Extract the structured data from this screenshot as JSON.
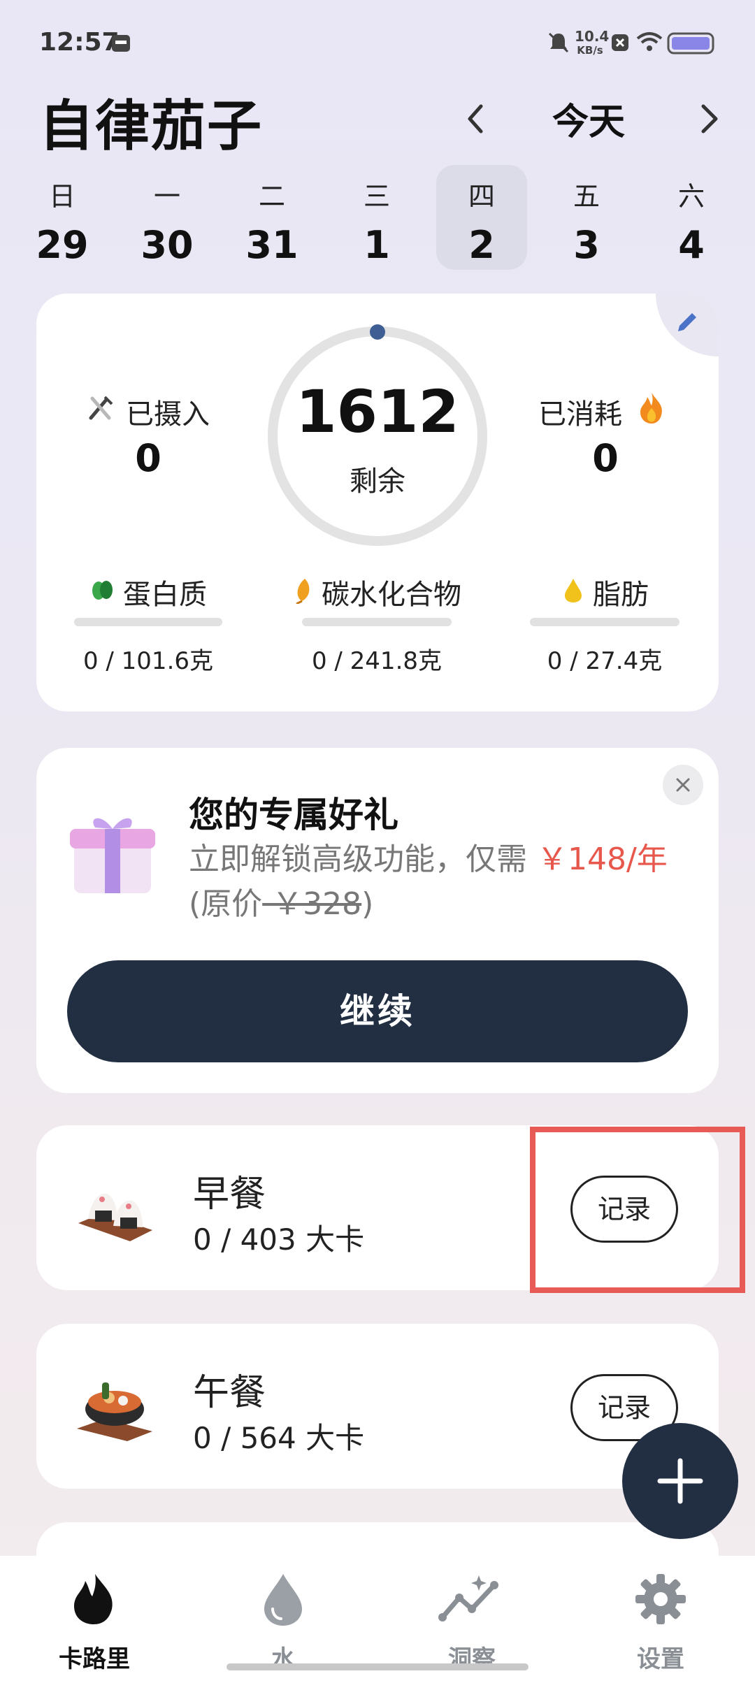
{
  "status_bar": {
    "time": "12:57",
    "net_speed_top": "10.4",
    "net_speed_bottom": "KB/s"
  },
  "header": {
    "title": "自律茄子",
    "date_label": "今天"
  },
  "week": [
    {
      "weekday": "日",
      "date": "29",
      "selected": false
    },
    {
      "weekday": "一",
      "date": "30",
      "selected": false
    },
    {
      "weekday": "二",
      "date": "31",
      "selected": false
    },
    {
      "weekday": "三",
      "date": "1",
      "selected": false
    },
    {
      "weekday": "四",
      "date": "2",
      "selected": true
    },
    {
      "weekday": "五",
      "date": "3",
      "selected": false
    },
    {
      "weekday": "六",
      "date": "4",
      "selected": false
    }
  ],
  "summary": {
    "intake_label": "已摄入",
    "intake_value": "0",
    "burned_label": "已消耗",
    "burned_value": "0",
    "remaining_value": "1612",
    "remaining_label": "剩余",
    "macros": [
      {
        "name": "蛋白质",
        "value": "0 / 101.6克",
        "icon": "bean-icon",
        "color": "#3aa84a"
      },
      {
        "name": "碳水化合物",
        "value": "0 / 241.8克",
        "icon": "grain-icon",
        "color": "#f0a021"
      },
      {
        "name": "脂肪",
        "value": "0 / 27.4克",
        "icon": "oil-drop-icon",
        "color": "#f1c21b"
      }
    ]
  },
  "promo": {
    "title": "您的专属好礼",
    "desc_prefix": "立即解锁高级功能，仅需 ",
    "price": "￥148/年",
    "orig_open": "(原价",
    "orig_price": " ￥328",
    "orig_close": ")",
    "button": "继续"
  },
  "meals": [
    {
      "name": "早餐",
      "calories": "0 / 403 大卡",
      "record": "记录"
    },
    {
      "name": "午餐",
      "calories": "0 / 564 大卡",
      "record": "记录"
    }
  ],
  "bottom_nav": [
    {
      "label": "卡路里",
      "icon": "flame-icon",
      "active": true
    },
    {
      "label": "水",
      "icon": "water-drop-icon",
      "active": false
    },
    {
      "label": "洞察",
      "icon": "insights-icon",
      "active": false
    },
    {
      "label": "设置",
      "icon": "gear-icon",
      "active": false
    }
  ],
  "colors": {
    "accent": "#222f42",
    "price": "#e8574c",
    "highlight": "#e85a55"
  }
}
